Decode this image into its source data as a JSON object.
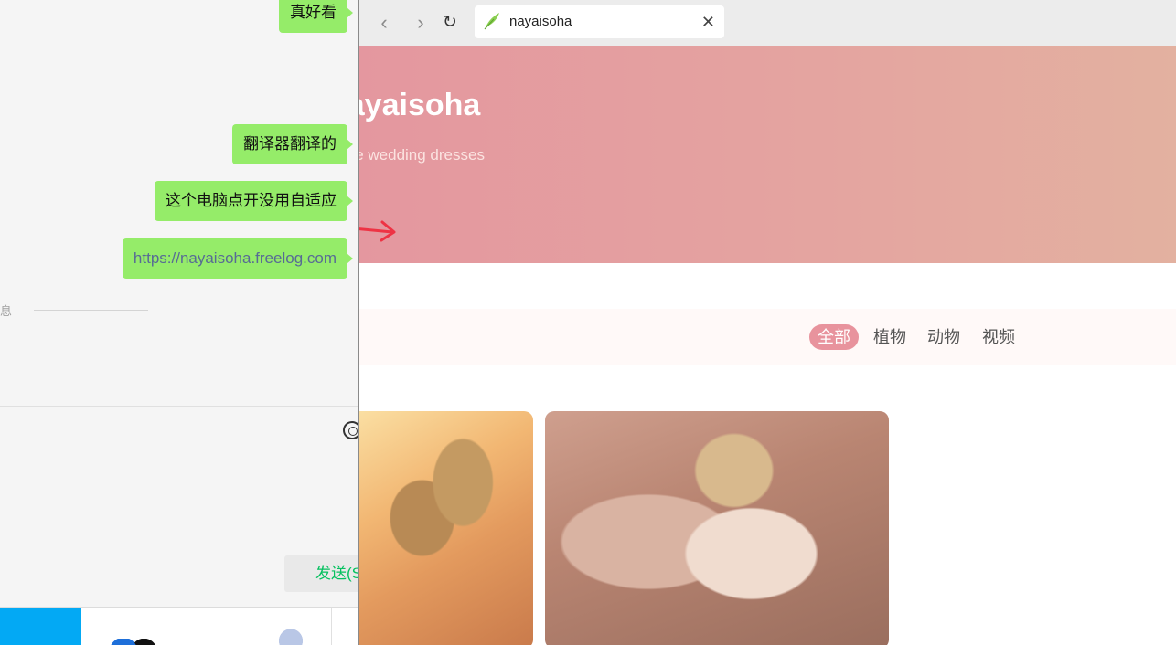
{
  "chat": {
    "messages": [
      {
        "text": "真好看",
        "type": "text"
      },
      {
        "text": "翻译器翻译的",
        "type": "text"
      },
      {
        "text": "这个电脑点开没用自适应",
        "type": "text"
      },
      {
        "text": "https://nayaisoha.freelog.com",
        "type": "link"
      }
    ],
    "separator_label": "消息",
    "send_label": "发送(S"
  },
  "browser": {
    "tab": {
      "title": "nayaisoha",
      "icon": "feather-icon",
      "close": "✕"
    },
    "nav": {
      "back": "‹",
      "forward": "›",
      "reload": "↻"
    },
    "hero": {
      "title": "nayaisoha",
      "subtitle": "Antique wedding dresses",
      "gradient_start": "#e4979f",
      "gradient_end": "#e3b1a0"
    },
    "filters": [
      {
        "label": "全部",
        "active": true
      },
      {
        "label": "植物",
        "active": false
      },
      {
        "label": "动物",
        "active": false
      },
      {
        "label": "视频",
        "active": false
      }
    ],
    "accent_color": "#e8939d"
  },
  "annotation": {
    "arrow_color": "#ee3344"
  },
  "colors": {
    "bubble": "#95ec69",
    "send_text": "#07c160",
    "taskbar_blue": "#03a9f4"
  }
}
